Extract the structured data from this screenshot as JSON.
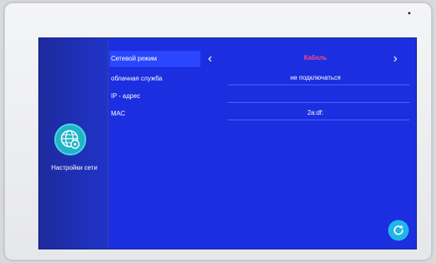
{
  "sidebar": {
    "icon": "network-settings-icon",
    "label": "Настройки сети"
  },
  "settings": {
    "network_mode": {
      "label": "Сетевой режим",
      "value": "Кабель"
    },
    "cloud_service": {
      "label": "облачная служба",
      "value": "не подключаться"
    },
    "ip_address": {
      "label": "IP - адрес",
      "value": ""
    },
    "mac": {
      "label": "MAC",
      "value": "2a:df:"
    }
  },
  "colors": {
    "screen_bg": "#1b2fe0",
    "highlight": "#2a47ff",
    "accent_value": "#ff4a7a",
    "icon_teal": "#20b4c8",
    "refresh_button": "#1fb6e8"
  },
  "icons": {
    "prev": "chevron-left-icon",
    "next": "chevron-right-icon",
    "refresh": "refresh-icon"
  }
}
